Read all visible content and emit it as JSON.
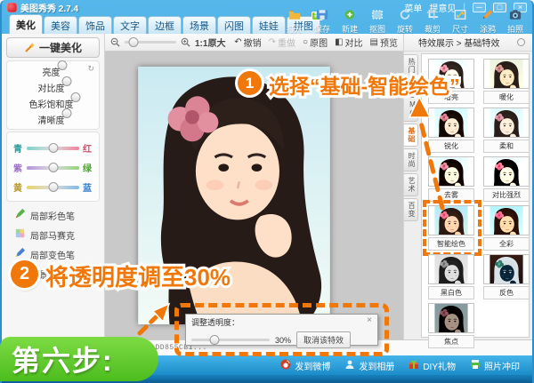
{
  "window": {
    "title": "美图秀秀 2.7.4",
    "menu_label": "菜单",
    "feedback_label": "提意见"
  },
  "tabs": [
    {
      "label": "美化",
      "active": true
    },
    {
      "label": "美容"
    },
    {
      "label": "饰品"
    },
    {
      "label": "文字"
    },
    {
      "label": "边框"
    },
    {
      "label": "场景"
    },
    {
      "label": "闪图"
    },
    {
      "label": "娃娃"
    },
    {
      "label": "拼图",
      "badge": "新"
    }
  ],
  "quick_toolbar": [
    {
      "label": "打开",
      "icon": "open-folder-icon"
    },
    {
      "label": "保存",
      "icon": "save-icon"
    },
    {
      "label": "新建",
      "icon": "new-icon"
    },
    {
      "label": "抠图",
      "icon": "cutout-icon"
    },
    {
      "label": "旋转",
      "icon": "rotate-icon"
    },
    {
      "label": "裁剪",
      "icon": "crop-icon"
    },
    {
      "label": "尺寸",
      "icon": "resize-icon"
    },
    {
      "label": "涂鸦",
      "icon": "doodle-icon"
    },
    {
      "label": "拍照",
      "icon": "camera-icon"
    }
  ],
  "canvas_toolbar": {
    "actual_size": "1:1原大",
    "undo": "撤销",
    "redo": "重做",
    "original": "原图",
    "compare": "对比",
    "preview": "预览"
  },
  "sidebar": {
    "one_key_label": "一键美化",
    "adjust_sliders": [
      {
        "label": "亮度",
        "reset": true,
        "value_pct": 50
      },
      {
        "label": "对比度",
        "value_pct": 50
      },
      {
        "label": "色彩饱和度",
        "value_pct": 50
      },
      {
        "label": "清晰度",
        "value_pct": 50
      }
    ],
    "color_sliders": [
      {
        "left": "青",
        "right": "红",
        "value_pct": 50
      },
      {
        "left": "紫",
        "right": "绿",
        "value_pct": 50
      },
      {
        "left": "黄",
        "right": "蓝",
        "value_pct": 50
      }
    ],
    "tools": [
      {
        "label": "局部彩色笔",
        "icon": "color-pen-icon"
      },
      {
        "label": "局部马赛克",
        "icon": "mosaic-icon"
      },
      {
        "label": "局部变色笔",
        "icon": "recolor-pen-icon"
      },
      {
        "label": "背景虚化",
        "icon": "blur-icon"
      }
    ]
  },
  "effects_panel": {
    "header": "特效展示 > 基础特效",
    "categories": [
      {
        "label": "热门"
      },
      {
        "label": "LOMO"
      },
      {
        "label": "基础",
        "selected": true
      },
      {
        "label": "时尚"
      },
      {
        "label": "艺术"
      },
      {
        "label": "百变"
      }
    ],
    "effects": [
      {
        "name": "增亮"
      },
      {
        "name": "暖化"
      },
      {
        "name": "锐化"
      },
      {
        "name": "柔和"
      },
      {
        "name": "去雾"
      },
      {
        "name": "对比强烈"
      },
      {
        "name": "智能绘色",
        "selected": true
      },
      {
        "name": "全彩"
      },
      {
        "name": "黑白色"
      },
      {
        "name": "反色"
      },
      {
        "name": "焦点"
      }
    ]
  },
  "dialog": {
    "title": "调整透明度：",
    "value": "30%",
    "value_pct": 30,
    "cancel_label": "取消该特效"
  },
  "statusbar": {
    "filename": "A1A0ADD855CB1..."
  },
  "bottombar": [
    {
      "label": "发到微博",
      "icon": "weibo-icon"
    },
    {
      "label": "发到相册",
      "icon": "album-icon"
    },
    {
      "label": "DIY礼物",
      "icon": "gift-icon"
    },
    {
      "label": "照片冲印",
      "icon": "print-icon"
    }
  ],
  "annotations": {
    "step1_num": "1",
    "step1_text": "选择“基础-智能绘色”",
    "step2_num": "2",
    "step2_text": "将透明度调至30%",
    "banner": "第六步:"
  },
  "colors": {
    "accent_orange": "#f0780a",
    "banner_green": "#4cbd1e",
    "titlebar_blue": "#2a95d2"
  }
}
